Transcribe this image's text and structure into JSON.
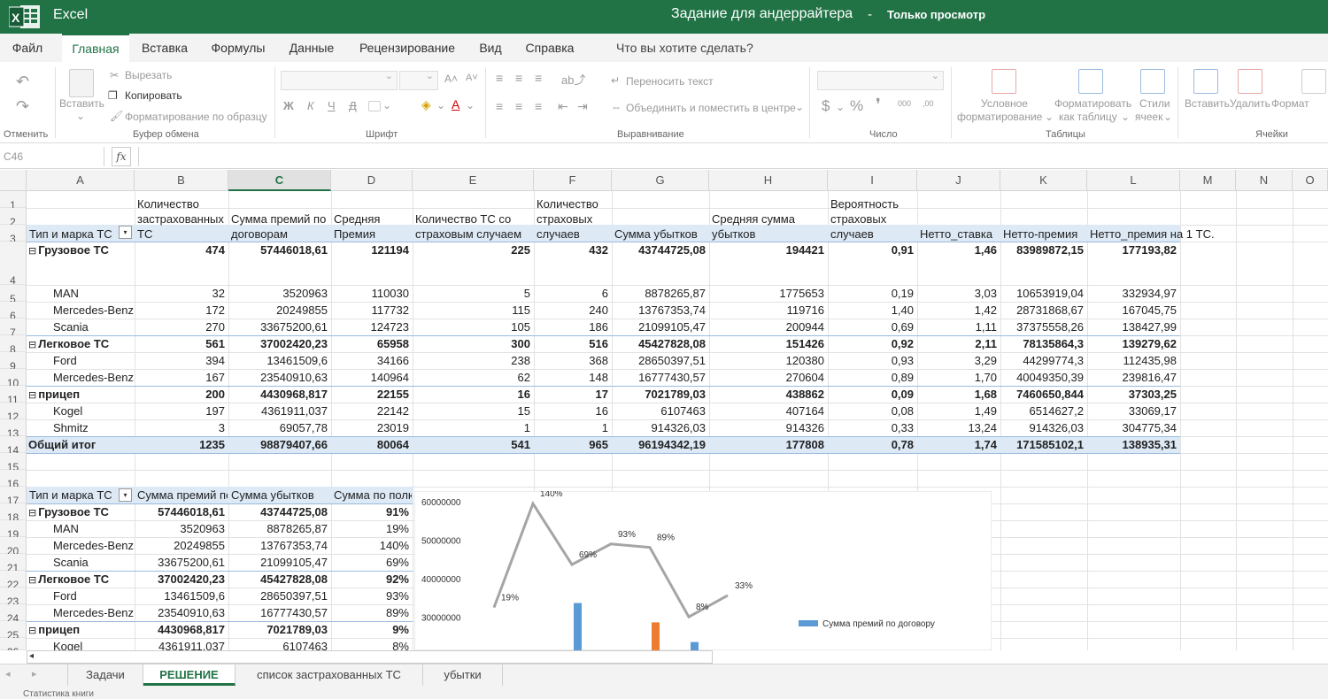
{
  "titlebar": {
    "app_name": "Excel",
    "doc_title": "Задание для андеррайтера",
    "separator": "-",
    "mode": "Только просмотр",
    "bg_color": "#217346"
  },
  "ribbon_tabs": [
    "Файл",
    "Главная",
    "Вставка",
    "Формулы",
    "Данные",
    "Рецензирование",
    "Вид",
    "Справка"
  ],
  "active_tab": "Главная",
  "tell_me": "Что вы хотите сделать?",
  "ribbon": {
    "undo_group": "Отменить",
    "paste": "Вставить",
    "cut": "Вырезать",
    "copy": "Копировать",
    "format_painter": "Форматирование по образцу",
    "clipboard_group": "Буфер обмена",
    "font_group": "Шрифт",
    "bold": "Ж",
    "italic": "К",
    "underline": "Ч",
    "strike": "Д",
    "wrap_text": "Переносить текст",
    "merge_center": "Объединить и поместить в центре",
    "alignment_group": "Выравнивание",
    "number_group": "Число",
    "currency": "$",
    "percent": "%",
    "comma": "000",
    "cond_format_1": "Условное",
    "cond_format_2": "форматирование",
    "format_table_1": "Форматировать",
    "format_table_2": "как таблицу",
    "styles_1": "Стили",
    "styles_2": "ячеек",
    "tables_group": "Таблицы",
    "insert": "Вставить",
    "delete": "Удалить",
    "format": "Формат",
    "cells_group": "Ячейки"
  },
  "formula_bar": {
    "name_box": "C46",
    "fx": "fx",
    "formula": ""
  },
  "columns": [
    "A",
    "B",
    "C",
    "D",
    "E",
    "F",
    "G",
    "H",
    "I",
    "J",
    "K",
    "L",
    "M",
    "N",
    "O"
  ],
  "selected_column": "C",
  "row_numbers": [
    "1",
    "2",
    "3",
    "4",
    "5",
    "6",
    "7",
    "8",
    "9",
    "10",
    "11",
    "12",
    "13",
    "14",
    "15",
    "16",
    "17",
    "18",
    "19",
    "20",
    "21",
    "22",
    "23",
    "24",
    "25",
    "26"
  ],
  "pivot1": {
    "headers": {
      "a": "Тип и марка ТС",
      "b": "Количество застрахованных ТС",
      "c": "Сумма премий по договорам",
      "d": "Средняя Премия",
      "e": "Количество ТС со страховым случаем",
      "f": "Количество страховых случаев",
      "g": "Сумма убытков",
      "h": "Средняя сумма убытков",
      "i": "Вероятность страховых случаев",
      "j": "Нетто_ставка",
      "k": "Нетто-премия",
      "l": "Нетто_премия на 1 ТС."
    },
    "rows": [
      {
        "label": "Грузовое ТС",
        "group": true,
        "v": [
          "474",
          "57446018,61",
          "121194",
          "225",
          "432",
          "43744725,08",
          "194421",
          "0,91",
          "1,46",
          "83989872,15",
          "177193,82"
        ]
      },
      {
        "label": "MAN",
        "group": false,
        "v": [
          "32",
          "3520963",
          "110030",
          "5",
          "6",
          "8878265,87",
          "1775653",
          "0,19",
          "3,03",
          "10653919,04",
          "332934,97"
        ]
      },
      {
        "label": "Mercedes-Benz",
        "group": false,
        "v": [
          "172",
          "20249855",
          "117732",
          "115",
          "240",
          "13767353,74",
          "119716",
          "1,40",
          "1,42",
          "28731868,67",
          "167045,75"
        ]
      },
      {
        "label": "Scania",
        "group": false,
        "v": [
          "270",
          "33675200,61",
          "124723",
          "105",
          "186",
          "21099105,47",
          "200944",
          "0,69",
          "1,11",
          "37375558,26",
          "138427,99"
        ]
      },
      {
        "label": "Легковое ТС",
        "group": true,
        "v": [
          "561",
          "37002420,23",
          "65958",
          "300",
          "516",
          "45427828,08",
          "151426",
          "0,92",
          "2,11",
          "78135864,3",
          "139279,62"
        ]
      },
      {
        "label": "Ford",
        "group": false,
        "v": [
          "394",
          "13461509,6",
          "34166",
          "238",
          "368",
          "28650397,51",
          "120380",
          "0,93",
          "3,29",
          "44299774,3",
          "112435,98"
        ]
      },
      {
        "label": "Mercedes-Benz",
        "group": false,
        "v": [
          "167",
          "23540910,63",
          "140964",
          "62",
          "148",
          "16777430,57",
          "270604",
          "0,89",
          "1,70",
          "40049350,39",
          "239816,47"
        ]
      },
      {
        "label": "прицеп",
        "group": true,
        "v": [
          "200",
          "4430968,817",
          "22155",
          "16",
          "17",
          "7021789,03",
          "438862",
          "0,09",
          "1,68",
          "7460650,844",
          "37303,25"
        ]
      },
      {
        "label": "Kogel",
        "group": false,
        "v": [
          "197",
          "4361911,037",
          "22142",
          "15",
          "16",
          "6107463",
          "407164",
          "0,08",
          "1,49",
          "6514627,2",
          "33069,17"
        ]
      },
      {
        "label": "Shmitz",
        "group": false,
        "v": [
          "3",
          "69057,78",
          "23019",
          "1",
          "1",
          "914326,03",
          "914326",
          "0,33",
          "13,24",
          "914326,03",
          "304775,34"
        ]
      },
      {
        "label": "Общий итог",
        "group": true,
        "total": true,
        "v": [
          "1235",
          "98879407,66",
          "80064",
          "541",
          "965",
          "96194342,19",
          "177808",
          "0,78",
          "1,74",
          "171585102,1",
          "138935,31"
        ]
      }
    ]
  },
  "pivot2": {
    "headers": [
      "Тип и марка ТС",
      "Сумма премий по",
      "Сумма убытков",
      "Сумма по полю"
    ],
    "rows": [
      {
        "label": "Грузовое ТС",
        "group": true,
        "v": [
          "57446018,61",
          "43744725,08",
          "91%"
        ]
      },
      {
        "label": "MAN",
        "group": false,
        "v": [
          "3520963",
          "8878265,87",
          "19%"
        ]
      },
      {
        "label": "Mercedes-Benz",
        "group": false,
        "v": [
          "20249855",
          "13767353,74",
          "140%"
        ]
      },
      {
        "label": "Scania",
        "group": false,
        "v": [
          "33675200,61",
          "21099105,47",
          "69%"
        ]
      },
      {
        "label": "Легковое ТС",
        "group": true,
        "v": [
          "37002420,23",
          "45427828,08",
          "92%"
        ]
      },
      {
        "label": "Ford",
        "group": false,
        "v": [
          "13461509,6",
          "28650397,51",
          "93%"
        ]
      },
      {
        "label": "Mercedes-Benz",
        "group": false,
        "v": [
          "23540910,63",
          "16777430,57",
          "89%"
        ]
      },
      {
        "label": "прицеп",
        "group": true,
        "v": [
          "4430968,817",
          "7021789,03",
          "9%"
        ]
      },
      {
        "label": "Kogel",
        "group": false,
        "v": [
          "4361911,037",
          "6107463",
          "8%"
        ]
      }
    ]
  },
  "chart_data": {
    "type": "bar",
    "y_ticks": [
      "60000000",
      "50000000",
      "40000000",
      "30000000"
    ],
    "ylim": [
      30000000,
      60000000
    ],
    "legend": "Сумма премий по договору",
    "legend_position": "right",
    "series": [
      {
        "name": "Сумма премий по договору",
        "color": "#5b9bd5",
        "values": [
          {
            "i": 2,
            "value": 33675200.61
          },
          {
            "i": 5,
            "value": 23540910.63
          }
        ]
      },
      {
        "color": "#ed7d31",
        "values": [
          {
            "i": 4,
            "value": 28650397.51
          }
        ]
      }
    ],
    "line": {
      "color": "#a5a5a5",
      "points": [
        {
          "label": "19%",
          "value": 0.19
        },
        {
          "label": "140%",
          "value": 1.4
        },
        {
          "label": "69%",
          "value": 0.69
        },
        {
          "label": "93%",
          "value": 0.93
        },
        {
          "label": "89%",
          "value": 0.89
        },
        {
          "label": "8%",
          "value": 0.08
        },
        {
          "label": "33%",
          "value": 0.33
        }
      ]
    }
  },
  "sheets": [
    "Задачи",
    "РЕШЕНИЕ",
    "список застрахованных ТС",
    "убытки"
  ],
  "active_sheet": "РЕШЕНИЕ",
  "status": "Статистика книги"
}
